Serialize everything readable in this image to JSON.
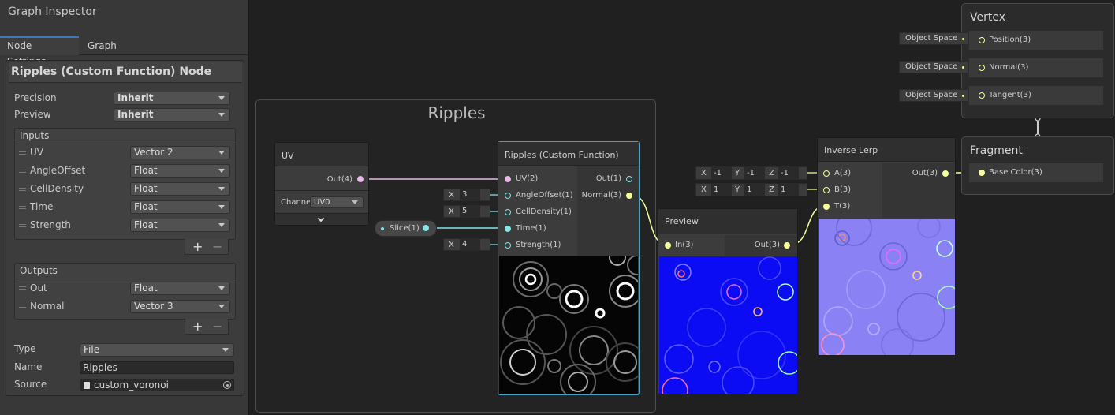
{
  "inspector": {
    "title": "Graph Inspector",
    "tabs": [
      "Node Settings",
      "Graph Settings"
    ],
    "node_title": "Ripples (Custom Function) Node",
    "precision_label": "Precision",
    "precision_value": "Inherit",
    "preview_label": "Preview",
    "preview_value": "Inherit",
    "inputs_header": "Inputs",
    "inputs": [
      {
        "name": "UV",
        "type": "Vector 2"
      },
      {
        "name": "AngleOffset",
        "type": "Float"
      },
      {
        "name": "CellDensity",
        "type": "Float"
      },
      {
        "name": "Time",
        "type": "Float"
      },
      {
        "name": "Strength",
        "type": "Float"
      }
    ],
    "outputs_header": "Outputs",
    "outputs": [
      {
        "name": "Out",
        "type": "Float"
      },
      {
        "name": "Normal",
        "type": "Vector 3"
      }
    ],
    "plus": "+",
    "minus": "−",
    "type_label": "Type",
    "type_value": "File",
    "name_label": "Name",
    "name_value": "Ripples",
    "source_label": "Source",
    "source_value": "custom_voronoi"
  },
  "group": {
    "title": "Ripples"
  },
  "uv_node": {
    "title": "UV",
    "out_port": "Out(4)",
    "channel_label": "Channe",
    "channel_value": "UV0"
  },
  "slice_node": {
    "label": "Slice(1)"
  },
  "ripples_node": {
    "title": "Ripples (Custom Function)",
    "inputs": [
      "UV(2)",
      "AngleOffset(1)",
      "CellDensity(1)",
      "Time(1)",
      "Strength(1)"
    ],
    "outputs": [
      "Out(1)",
      "Normal(3)"
    ],
    "defaults": [
      {
        "axis": "X",
        "value": "3"
      },
      {
        "axis": "X",
        "value": "5"
      },
      {
        "axis": "X",
        "value": "4"
      }
    ]
  },
  "preview_node": {
    "title": "Preview",
    "in_port": "In(3)",
    "out_port": "Out(3)"
  },
  "lerp_node": {
    "title": "Inverse Lerp",
    "inputs": [
      "A(3)",
      "B(3)",
      "T(3)"
    ],
    "output": "Out(3)",
    "a_values": [
      {
        "axis": "X",
        "value": "-1"
      },
      {
        "axis": "Y",
        "value": "-1"
      },
      {
        "axis": "Z",
        "value": "-1"
      }
    ],
    "b_values": [
      {
        "axis": "X",
        "value": "1"
      },
      {
        "axis": "Y",
        "value": "1"
      },
      {
        "axis": "Z",
        "value": "1"
      }
    ]
  },
  "vertex": {
    "title": "Vertex",
    "slots": [
      "Position(3)",
      "Normal(3)",
      "Tangent(3)"
    ],
    "spaces": [
      "Object Space",
      "Object Space",
      "Object Space"
    ]
  },
  "fragment": {
    "title": "Fragment",
    "slot": "Base Color(3)"
  },
  "colors": {
    "uv_wire": "#e9b8e6",
    "float_wire": "#84e4e7",
    "vector3_wire": "#f6ff9a",
    "selection": "#44a3c9"
  }
}
